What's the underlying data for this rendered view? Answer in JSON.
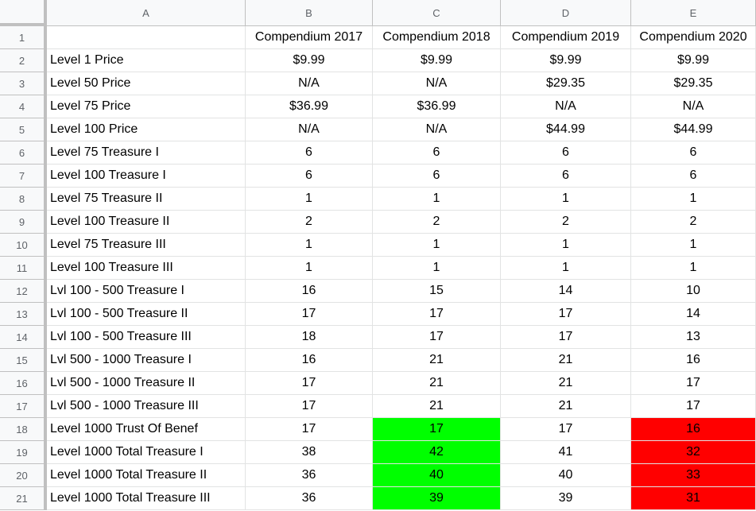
{
  "columns": [
    "A",
    "B",
    "C",
    "D",
    "E"
  ],
  "rows": [
    {
      "num": "1",
      "label": "",
      "values": [
        "Compendium 2017",
        "Compendium 2018",
        "Compendium 2019",
        "Compendium 2020"
      ]
    },
    {
      "num": "2",
      "label": "Level 1 Price",
      "values": [
        "$9.99",
        "$9.99",
        "$9.99",
        "$9.99"
      ]
    },
    {
      "num": "3",
      "label": "Level 50 Price",
      "values": [
        "N/A",
        "N/A",
        "$29.35",
        "$29.35"
      ]
    },
    {
      "num": "4",
      "label": "Level 75 Price",
      "values": [
        "$36.99",
        "$36.99",
        "N/A",
        "N/A"
      ]
    },
    {
      "num": "5",
      "label": "Level 100 Price",
      "values": [
        "N/A",
        "N/A",
        "$44.99",
        "$44.99"
      ]
    },
    {
      "num": "6",
      "label": "Level 75 Treasure I",
      "values": [
        "6",
        "6",
        "6",
        "6"
      ]
    },
    {
      "num": "7",
      "label": "Level 100 Treasure I",
      "values": [
        "6",
        "6",
        "6",
        "6"
      ]
    },
    {
      "num": "8",
      "label": "Level 75 Treasure II",
      "values": [
        "1",
        "1",
        "1",
        "1"
      ]
    },
    {
      "num": "9",
      "label": "Level 100 Treasure II",
      "values": [
        "2",
        "2",
        "2",
        "2"
      ]
    },
    {
      "num": "10",
      "label": "Level 75 Treasure III",
      "values": [
        "1",
        "1",
        "1",
        "1"
      ]
    },
    {
      "num": "11",
      "label": "Level 100 Treasure III",
      "values": [
        "1",
        "1",
        "1",
        "1"
      ]
    },
    {
      "num": "12",
      "label": "Lvl 100 - 500 Treasure I",
      "values": [
        "16",
        "15",
        "14",
        "10"
      ]
    },
    {
      "num": "13",
      "label": "Lvl 100 - 500 Treasure II",
      "values": [
        "17",
        "17",
        "17",
        "14"
      ]
    },
    {
      "num": "14",
      "label": "Lvl 100 - 500 Treasure III",
      "values": [
        "18",
        "17",
        "17",
        "13"
      ]
    },
    {
      "num": "15",
      "label": "Lvl 500 - 1000 Treasure I",
      "values": [
        "16",
        "21",
        "21",
        "16"
      ]
    },
    {
      "num": "16",
      "label": "Lvl 500 - 1000 Treasure II",
      "values": [
        "17",
        "21",
        "21",
        "17"
      ]
    },
    {
      "num": "17",
      "label": "Lvl 500 - 1000 Treasure III",
      "values": [
        "17",
        "21",
        "21",
        "17"
      ]
    },
    {
      "num": "18",
      "label": "Level 1000 Trust Of Benef",
      "values": [
        "17",
        "17",
        "17",
        "16"
      ],
      "fills": [
        "",
        "green",
        "",
        "red"
      ]
    },
    {
      "num": "19",
      "label": "Level 1000 Total Treasure I",
      "values": [
        "38",
        "42",
        "41",
        "32"
      ],
      "fills": [
        "",
        "green",
        "",
        "red"
      ]
    },
    {
      "num": "20",
      "label": "Level 1000 Total Treasure II",
      "values": [
        "36",
        "40",
        "40",
        "33"
      ],
      "fills": [
        "",
        "green",
        "",
        "red"
      ]
    },
    {
      "num": "21",
      "label": "Level 1000 Total Treasure III",
      "values": [
        "36",
        "39",
        "39",
        "31"
      ],
      "fills": [
        "",
        "green",
        "",
        "red"
      ]
    }
  ],
  "colors": {
    "green": "#00ff00",
    "red": "#ff0000",
    "header_bg": "#f8f9fa",
    "gridline": "#e2e3e3"
  }
}
